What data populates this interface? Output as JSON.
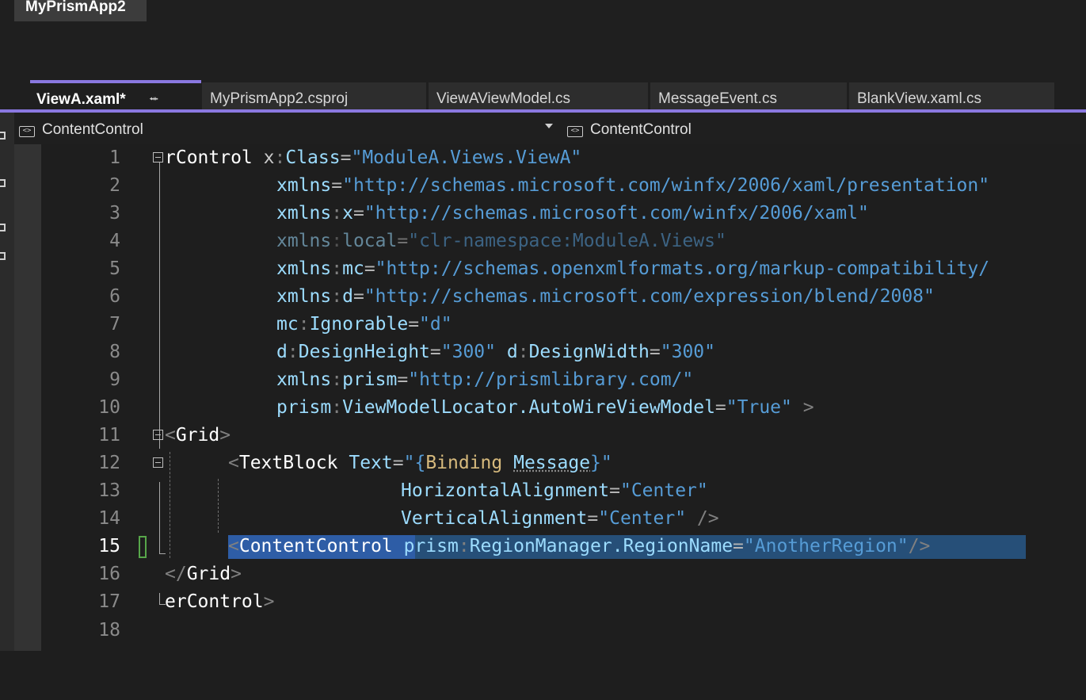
{
  "window": {
    "solution_name": "MyPrismApp2"
  },
  "tabs": [
    {
      "label": "ViewA.xaml*",
      "active": true,
      "pin_icon": "pin-icon",
      "close_icon": "close-icon"
    },
    {
      "label": "MyPrismApp2.csproj"
    },
    {
      "label": "ViewAViewModel.cs"
    },
    {
      "label": "MessageEvent.cs"
    },
    {
      "label": "BlankView.xaml.cs"
    }
  ],
  "navbar": {
    "left_dropdown": "ContentControl",
    "right_dropdown": "ContentControl",
    "icon": "xaml-element-icon"
  },
  "editor": {
    "current_line": 15,
    "line_numbers": [
      "1",
      "2",
      "3",
      "4",
      "5",
      "6",
      "7",
      "8",
      "9",
      "10",
      "11",
      "12",
      "13",
      "14",
      "15",
      "16",
      "17",
      "18"
    ],
    "lines": {
      "l1": {
        "tag": "rControl",
        "attr_ns": "x",
        "attr": "Class",
        "value": "\"ModuleA.Views.ViewA\""
      },
      "l2": {
        "attr": "xmlns",
        "value": "\"http://schemas.microsoft.com/winfx/2006/xaml/presentation\""
      },
      "l3": {
        "attr_ns": "xmlns",
        "attr": "x",
        "value": "\"http://schemas.microsoft.com/winfx/2006/xaml\""
      },
      "l4": {
        "attr_ns": "xmlns",
        "attr": "local",
        "value": "\"clr-namespace:ModuleA.Views\""
      },
      "l5": {
        "attr_ns": "xmlns",
        "attr": "mc",
        "value": "\"http://schemas.openxmlformats.org/markup-compatibility/"
      },
      "l6": {
        "attr_ns": "xmlns",
        "attr": "d",
        "value": "\"http://schemas.microsoft.com/expression/blend/2008\""
      },
      "l7": {
        "attr_ns": "mc",
        "attr": "Ignorable",
        "value": "\"d\""
      },
      "l8": {
        "attr_ns": "d",
        "attr": "DesignHeight",
        "value": "\"300\"",
        "attr2_ns": "d",
        "attr2": "DesignWidth",
        "value2": "\"300\""
      },
      "l9": {
        "attr_ns": "xmlns",
        "attr": "prism",
        "value": "\"http://prismlibrary.com/\""
      },
      "l10": {
        "attr_ns": "prism",
        "attr": "ViewModelLocator.AutoWireViewModel",
        "value": "\"True\"",
        "close": ">"
      },
      "l11": {
        "open": "<",
        "tag": "Grid",
        "close": ">"
      },
      "l12": {
        "open": "<",
        "tag": "TextBlock",
        "attr": "Text",
        "quote": "\"",
        "brace_open": "{",
        "binding_kw": "Binding",
        "binding_path": "Message",
        "brace_close": "}"
      },
      "l13": {
        "attr": "HorizontalAlignment",
        "value": "\"Center\""
      },
      "l14": {
        "attr": "VerticalAlignment",
        "value": "\"Center\"",
        "close": "/>"
      },
      "l15": {
        "open": "<",
        "tag": "ContentControl",
        "attr_ns": "prism",
        "attr": "RegionManager.RegionName",
        "value": "\"AnotherRegion\"",
        "close": "/>"
      },
      "l16": {
        "open": "</",
        "tag": "Grid",
        "close": ">"
      },
      "l17": {
        "tag": "erControl",
        "close": ">"
      }
    }
  },
  "colors": {
    "accent": "#8a78e0",
    "background": "#1e1e1e",
    "selection": "#264f78",
    "string": "#569cd6",
    "attribute": "#9cdcfe",
    "change_marker": "#57a64a"
  }
}
